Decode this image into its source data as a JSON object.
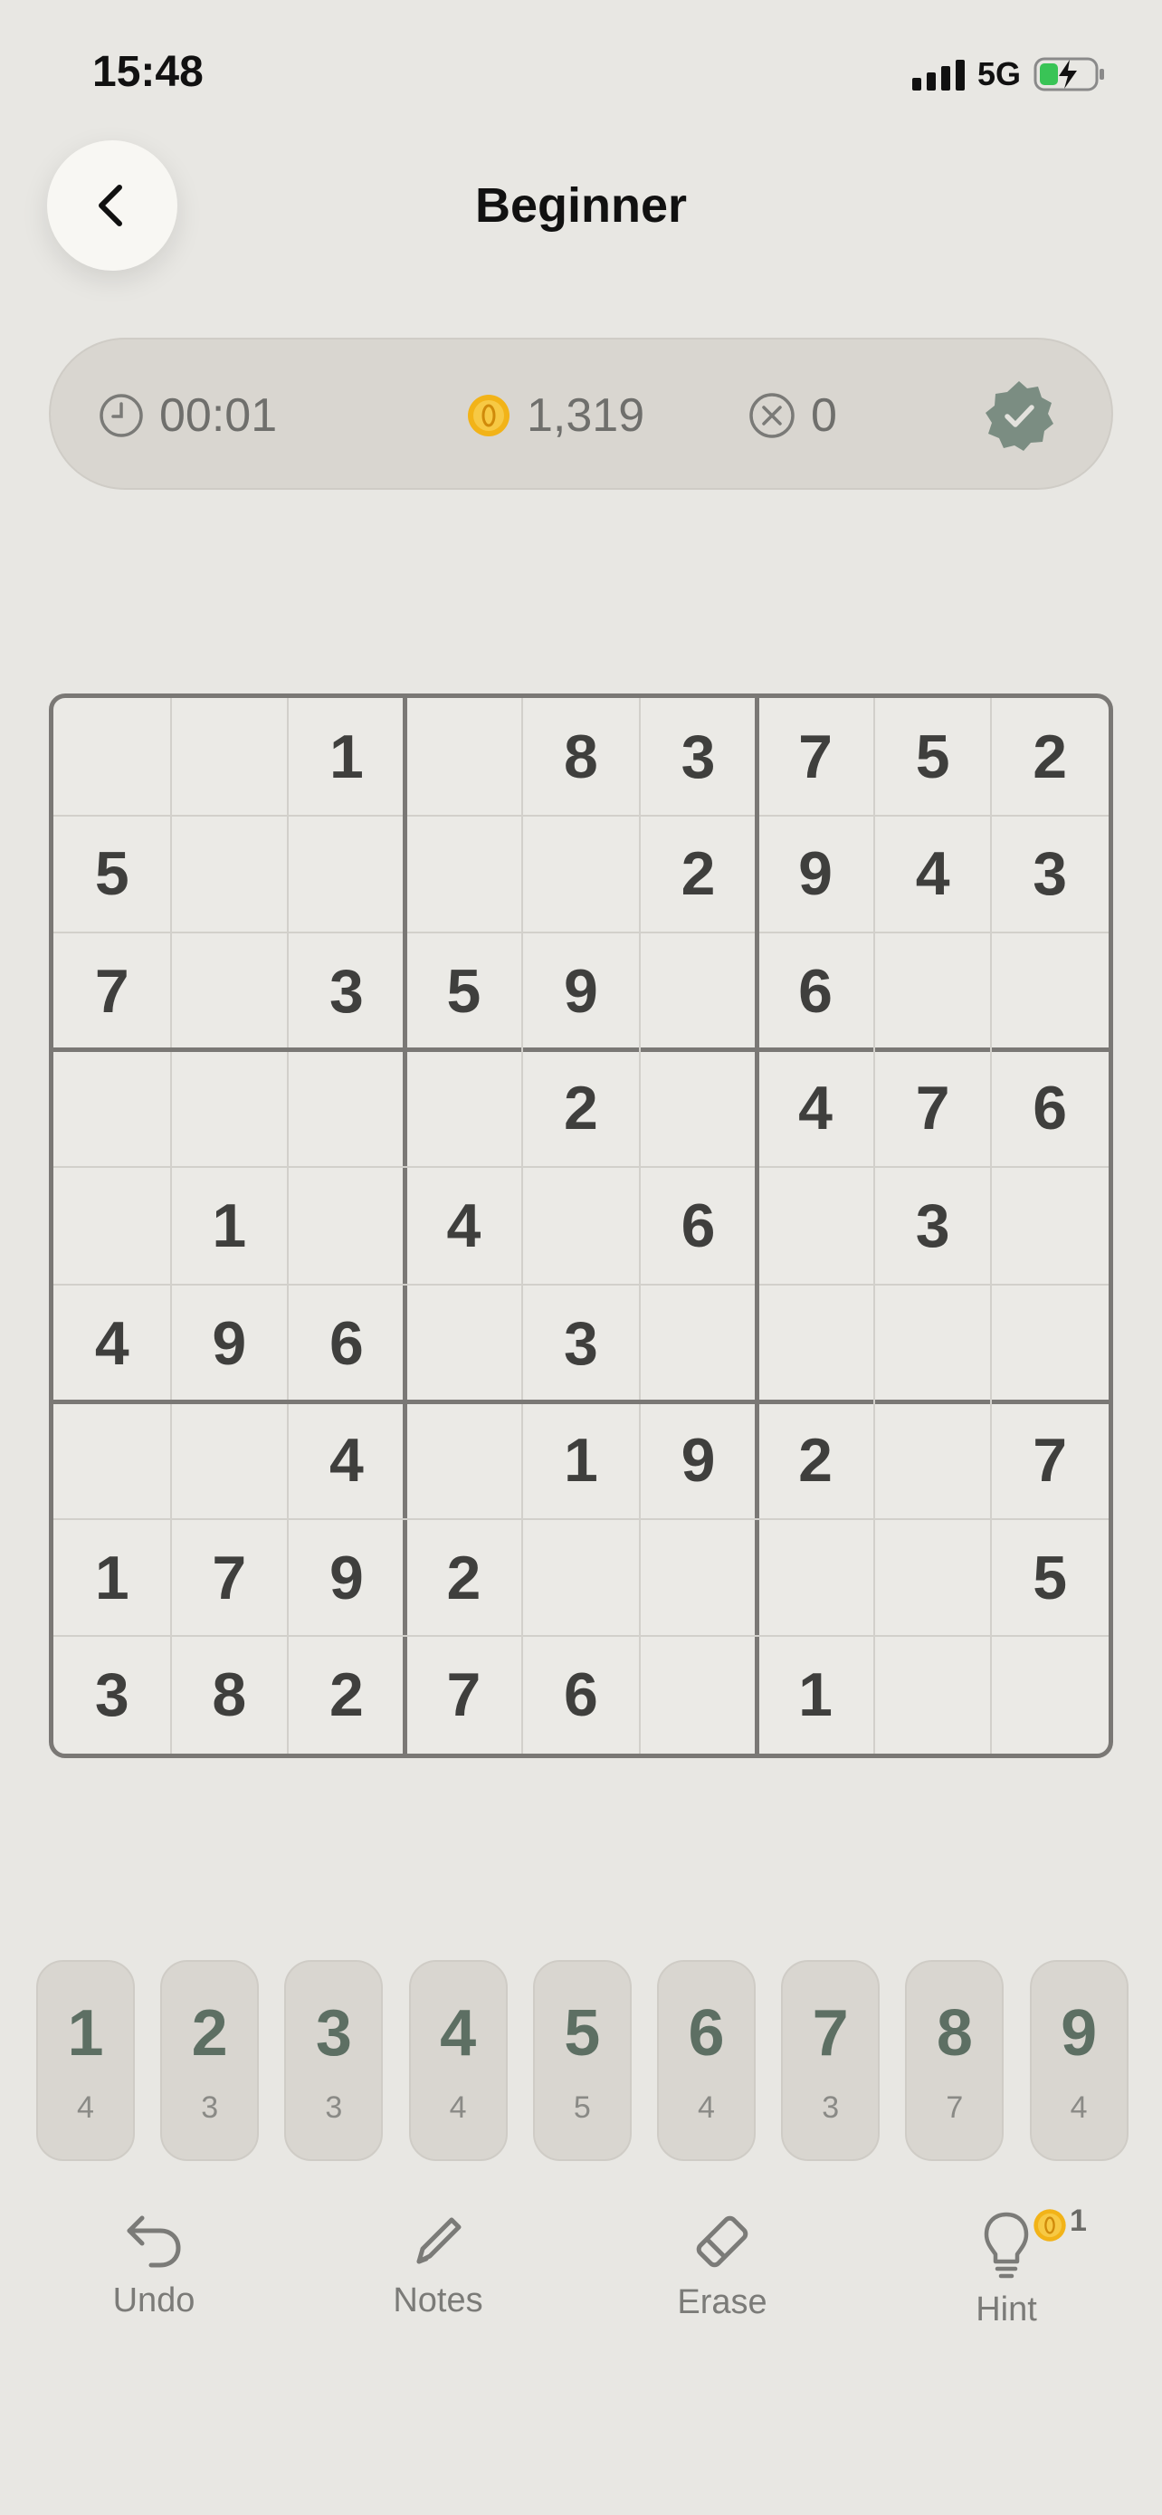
{
  "status": {
    "time": "15:48",
    "network": "5G"
  },
  "header": {
    "title": "Beginner",
    "back_icon": "chevron-left-icon"
  },
  "info": {
    "timer": "00:01",
    "coins": "1,319",
    "mistakes": "0"
  },
  "board": [
    [
      "",
      "",
      "1",
      "",
      "8",
      "3",
      "7",
      "5",
      "2"
    ],
    [
      "5",
      "",
      "",
      "",
      "",
      "2",
      "9",
      "4",
      "3"
    ],
    [
      "7",
      "",
      "3",
      "5",
      "9",
      "",
      "6",
      "",
      ""
    ],
    [
      "",
      "",
      "",
      "",
      "2",
      "",
      "4",
      "7",
      "6"
    ],
    [
      "",
      "1",
      "",
      "4",
      "",
      "6",
      "",
      "3",
      ""
    ],
    [
      "4",
      "9",
      "6",
      "",
      "3",
      "",
      "",
      "",
      ""
    ],
    [
      "",
      "",
      "4",
      "",
      "1",
      "9",
      "2",
      "",
      "7"
    ],
    [
      "1",
      "7",
      "9",
      "2",
      "",
      "",
      "",
      "",
      "5"
    ],
    [
      "3",
      "8",
      "2",
      "7",
      "6",
      "",
      "1",
      "",
      ""
    ]
  ],
  "numpad": [
    {
      "digit": "1",
      "count": "4"
    },
    {
      "digit": "2",
      "count": "3"
    },
    {
      "digit": "3",
      "count": "3"
    },
    {
      "digit": "4",
      "count": "4"
    },
    {
      "digit": "5",
      "count": "5"
    },
    {
      "digit": "6",
      "count": "4"
    },
    {
      "digit": "7",
      "count": "3"
    },
    {
      "digit": "8",
      "count": "7"
    },
    {
      "digit": "9",
      "count": "4"
    }
  ],
  "toolbar": {
    "undo": "Undo",
    "notes": "Notes",
    "erase": "Erase",
    "hint": "Hint",
    "hint_cost": "1"
  },
  "colors": {
    "background": "#e8e7e3",
    "accent_green": "#5d6f63",
    "battery_green": "#39c456",
    "coin_gold": "#f2b318"
  }
}
